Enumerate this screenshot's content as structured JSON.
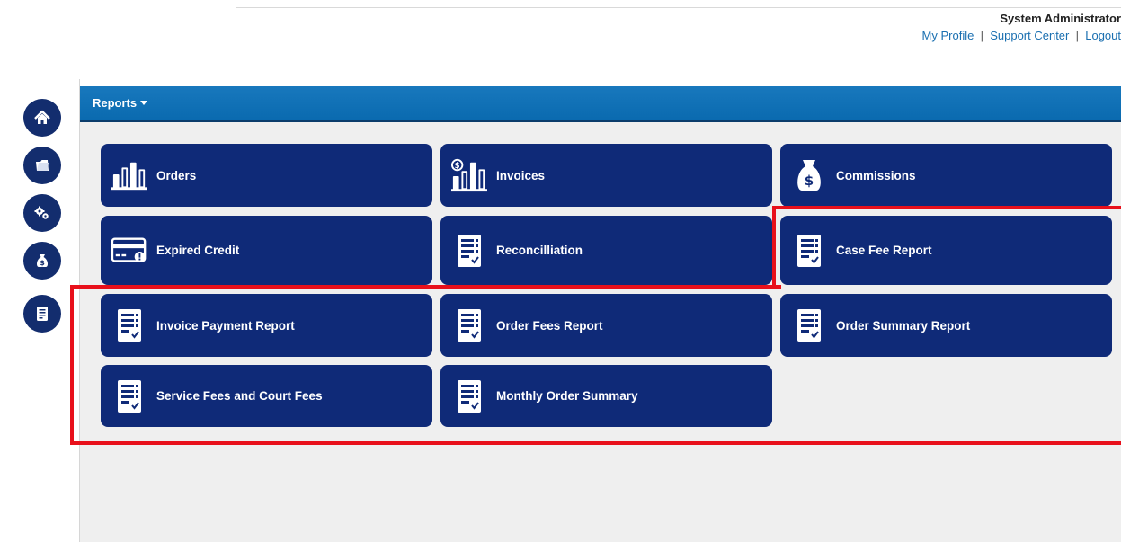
{
  "header": {
    "user_name": "System Administrator",
    "links": [
      "My Profile",
      "Support Center",
      "Logout"
    ]
  },
  "sidebar": {
    "items": [
      {
        "name": "home",
        "icon": "home-icon"
      },
      {
        "name": "folder",
        "icon": "folder-icon"
      },
      {
        "name": "settings",
        "icon": "gears-icon"
      },
      {
        "name": "money",
        "icon": "money-bag-icon"
      },
      {
        "name": "reports",
        "icon": "report-icon"
      }
    ]
  },
  "menu": {
    "reports_label": "Reports"
  },
  "tiles": [
    {
      "label": "Orders",
      "icon": "bar-chart-icon"
    },
    {
      "label": "Invoices",
      "icon": "invoice-chart-icon"
    },
    {
      "label": "Commissions",
      "icon": "money-bag-icon"
    },
    {
      "label": "Expired Credit",
      "icon": "credit-card-icon"
    },
    {
      "label": "Reconcilliation",
      "icon": "report-icon"
    },
    {
      "label": "Case Fee Report",
      "icon": "report-icon"
    },
    {
      "label": "Invoice Payment Report",
      "icon": "report-icon"
    },
    {
      "label": "Order Fees Report",
      "icon": "report-icon"
    },
    {
      "label": "Order Summary Report",
      "icon": "report-icon"
    },
    {
      "label": "Service Fees and Court Fees",
      "icon": "report-icon"
    },
    {
      "label": "Monthly Order Summary",
      "icon": "report-icon"
    }
  ],
  "colors": {
    "tile": "#0f2a78",
    "header_bar": "#0a6aaf",
    "highlight": "#e8101b",
    "link": "#1a6fb0"
  }
}
